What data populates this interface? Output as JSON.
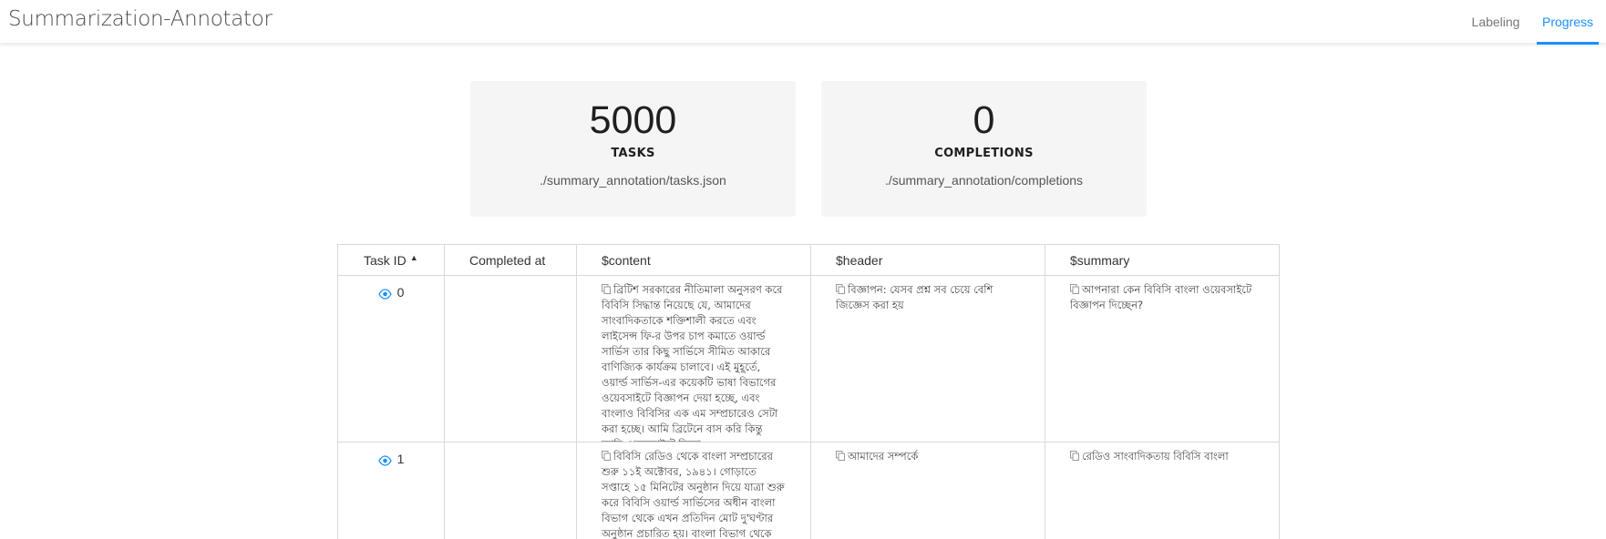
{
  "app": {
    "title": "Summarization-Annotator"
  },
  "nav": {
    "items": [
      {
        "label": "Labeling",
        "active": false
      },
      {
        "label": "Progress",
        "active": true
      }
    ],
    "accent_color": "#1890ff"
  },
  "stats": {
    "tasks": {
      "value": "5000",
      "label": "TASKS",
      "path": "./summary_annotation/tasks.json"
    },
    "completions": {
      "value": "0",
      "label": "COMPLETIONS",
      "path": "./summary_annotation/completions"
    }
  },
  "table": {
    "columns": [
      "Task ID",
      "Completed at",
      "$content",
      "$header",
      "$summary"
    ],
    "sort": {
      "column": "Task ID",
      "direction": "ascending"
    },
    "rows": [
      {
        "id": "0",
        "completed_at": "",
        "content": "ব্রিটিশ সরকারের নীতিমালা অনুসরণ করে বিবিসি সিদ্ধান্ত নিয়েছে যে, আমাদের সাংবাদিকতাকে শক্তিশালী করতে এবং লাইসেন্স ফি-র উপর চাপ কমাতে ওয়ার্ল্ড সার্ভিস তার কিছু সার্ভিসে সীমিত আকারে বাণিজ্যিক কার্যক্রম চালাবে। এই মুহূর্তে, ওয়ার্ল্ড সার্ভিস-এর কয়েকটি ভাষা বিভাগের ওয়েবসাইটে বিজ্ঞাপন দেয়া হচ্ছে, এবং বাংলাও বিবিসির এক এম সম্প্রচারেও সেটা করা হচ্ছে। আমি ব্রিটেনে বাস করি কিন্তু আমি ওয়েবসাইটে বিজ্ঞা ...",
        "header": "বিজ্ঞাপন: যেসব প্রশ্ন সব চেয়ে বেশি জিজ্ঞেস করা হয়",
        "summary": "আপনারা কেন বিবিসি বাংলা ওয়েবসাইটে বিজ্ঞাপন দিচ্ছেন?"
      },
      {
        "id": "1",
        "completed_at": "",
        "content": "বিবিসি রেডিও থেকে বাংলা সম্প্রচারের শুরু ১১ই অক্টোবর, ১৯৪১। গোড়াতে সপ্তাহে ১৫ মিনিটের অনুষ্ঠান দিয়ে যাত্রা শুরু করে বিবিসি ওয়ার্ল্ড সার্ভিসের অধীন বাংলা বিভাগ থেকে এখন প্রতিদিন মোট দু'ঘণ্টার অনুষ্ঠান প্রচারিত হয়। বাংলা বিভাগ থেকে প্রচারিত সংবাদ ও সাময়িক প্রসঙ্গের",
        "header": "আমাদের সম্পর্কে",
        "summary": "রেডিও সাংবাদিকতায় বিবিসি বাংলা"
      }
    ]
  },
  "icons": {
    "view": "eye-icon",
    "copy": "copy-icon",
    "sort": "caret-up-icon"
  }
}
